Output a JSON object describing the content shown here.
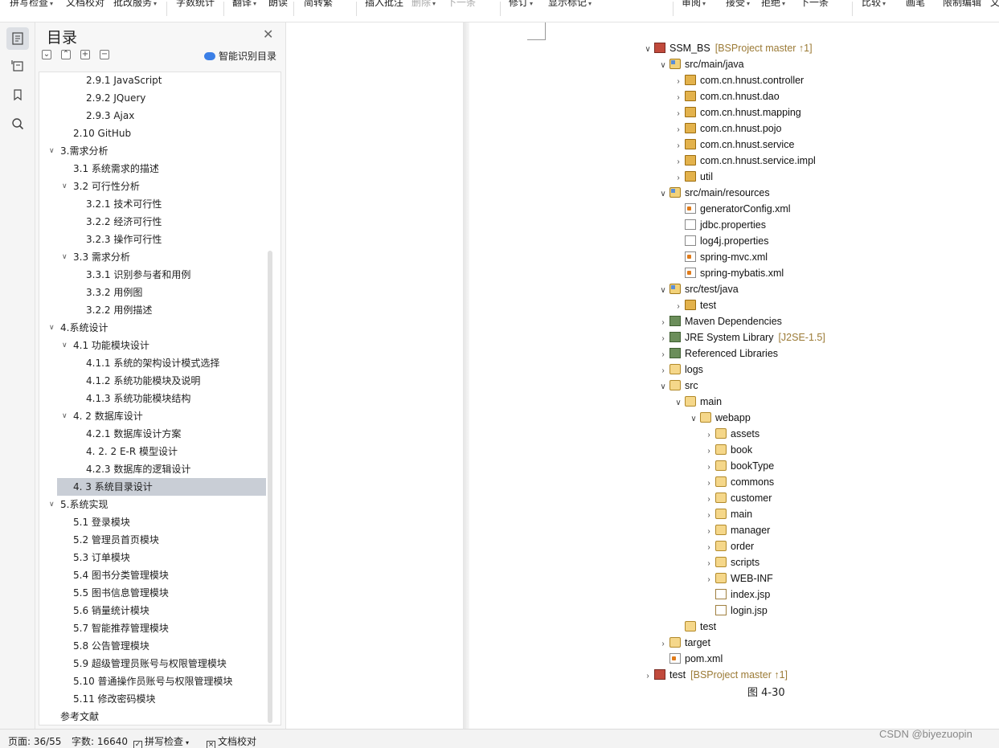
{
  "toolbar": {
    "items": [
      {
        "label": "拼写检查",
        "caret": true
      },
      {
        "label": "文档校对",
        "caret": false
      },
      {
        "label": "批改服务",
        "caret": true
      },
      {
        "label": "字数统计",
        "caret": false
      },
      {
        "label": "翻译",
        "caret": true
      },
      {
        "label": "朗读",
        "caret": false
      },
      {
        "label": "简转繁",
        "caret": false
      },
      {
        "label": "插入批注",
        "caret": false
      },
      {
        "label": "删除",
        "caret": true,
        "disabled": true
      },
      {
        "label": "下一条",
        "caret": false,
        "disabled": true
      },
      {
        "label": "修订",
        "caret": true
      },
      {
        "label": "显示标记",
        "caret": true
      },
      {
        "label": "审阅",
        "caret": true
      },
      {
        "label": "接受",
        "caret": true
      },
      {
        "label": "拒绝",
        "caret": true
      },
      {
        "label": "下一条",
        "caret": false
      },
      {
        "label": "比较",
        "caret": true
      },
      {
        "label": "画笔",
        "caret": false
      },
      {
        "label": "限制编辑",
        "caret": false
      },
      {
        "label": "文",
        "caret": false
      }
    ]
  },
  "toc": {
    "title": "目录",
    "smart_label": "智能识别目录",
    "items": [
      {
        "text": "2.9.1 JavaScript",
        "level": 3,
        "arrow": ""
      },
      {
        "text": "2.9.2 JQuery",
        "level": 3,
        "arrow": ""
      },
      {
        "text": "2.9.3 Ajax",
        "level": 3,
        "arrow": ""
      },
      {
        "text": "2.10 GitHub",
        "level": 2,
        "arrow": ""
      },
      {
        "text": "3.需求分析",
        "level": 1,
        "arrow": "∨"
      },
      {
        "text": "3.1  系统需求的描述",
        "level": 2,
        "arrow": ""
      },
      {
        "text": "3.2  可行性分析",
        "level": 2,
        "arrow": "∨"
      },
      {
        "text": "3.2.1 技术可行性",
        "level": 3,
        "arrow": ""
      },
      {
        "text": "3.2.2 经济可行性",
        "level": 3,
        "arrow": ""
      },
      {
        "text": "3.2.3 操作可行性",
        "level": 3,
        "arrow": ""
      },
      {
        "text": "3.3  需求分析",
        "level": 2,
        "arrow": "∨"
      },
      {
        "text": "3.3.1  识别参与者和用例",
        "level": 3,
        "arrow": ""
      },
      {
        "text": "3.3.2  用例图",
        "level": 3,
        "arrow": ""
      },
      {
        "text": "3.2.2 用例描述",
        "level": 3,
        "arrow": ""
      },
      {
        "text": "4.系统设计",
        "level": 1,
        "arrow": "∨"
      },
      {
        "text": "4.1 功能模块设计",
        "level": 2,
        "arrow": "∨"
      },
      {
        "text": "4.1.1 系统的架构设计模式选择",
        "level": 3,
        "arrow": ""
      },
      {
        "text": "4.1.2 系统功能模块及说明",
        "level": 3,
        "arrow": ""
      },
      {
        "text": "4.1.3 系统功能模块结构",
        "level": 3,
        "arrow": ""
      },
      {
        "text": "4. 2 数据库设计",
        "level": 2,
        "arrow": "∨"
      },
      {
        "text": "4.2.1 数据库设计方案",
        "level": 3,
        "arrow": ""
      },
      {
        "text": "4. 2. 2 E-R 模型设计",
        "level": 3,
        "arrow": ""
      },
      {
        "text": "4.2.3 数据库的逻辑设计",
        "level": 3,
        "arrow": ""
      },
      {
        "text": "4. 3  系统目录设计",
        "level": 2,
        "arrow": "",
        "selected": true
      },
      {
        "text": "5.系统实现",
        "level": 1,
        "arrow": "∨"
      },
      {
        "text": "5.1  登录模块",
        "level": 2,
        "arrow": ""
      },
      {
        "text": "5.2  管理员首页模块",
        "level": 2,
        "arrow": ""
      },
      {
        "text": "5.3  订单模块",
        "level": 2,
        "arrow": ""
      },
      {
        "text": "5.4  图书分类管理模块",
        "level": 2,
        "arrow": ""
      },
      {
        "text": "5.5  图书信息管理模块",
        "level": 2,
        "arrow": ""
      },
      {
        "text": "5.6  销量统计模块",
        "level": 2,
        "arrow": ""
      },
      {
        "text": "5.7  智能推荐管理模块",
        "level": 2,
        "arrow": ""
      },
      {
        "text": "5.8  公告管理模块",
        "level": 2,
        "arrow": ""
      },
      {
        "text": "5.9  超级管理员账号与权限管理模块",
        "level": 2,
        "arrow": ""
      },
      {
        "text": "5.10  普通操作员账号与权限管理模块",
        "level": 2,
        "arrow": ""
      },
      {
        "text": "5.11  修改密码模块",
        "level": 2,
        "arrow": ""
      },
      {
        "text": "参考文献",
        "level": 1,
        "arrow": ""
      }
    ]
  },
  "tree": {
    "rows": [
      {
        "indent": 0,
        "twisty": "∨",
        "icon": "proj",
        "label": "SSM_BS",
        "extra": "[BSProject master ↑1]"
      },
      {
        "indent": 1,
        "twisty": "∨",
        "icon": "srcfolder",
        "label": "src/main/java",
        "extra": ""
      },
      {
        "indent": 2,
        "twisty": "›",
        "icon": "pkg",
        "label": "com.cn.hnust.controller",
        "extra": ""
      },
      {
        "indent": 2,
        "twisty": "›",
        "icon": "pkg",
        "label": "com.cn.hnust.dao",
        "extra": ""
      },
      {
        "indent": 2,
        "twisty": "›",
        "icon": "pkg",
        "label": "com.cn.hnust.mapping",
        "extra": ""
      },
      {
        "indent": 2,
        "twisty": "›",
        "icon": "pkg",
        "label": "com.cn.hnust.pojo",
        "extra": ""
      },
      {
        "indent": 2,
        "twisty": "›",
        "icon": "pkg",
        "label": "com.cn.hnust.service",
        "extra": ""
      },
      {
        "indent": 2,
        "twisty": "›",
        "icon": "pkg",
        "label": "com.cn.hnust.service.impl",
        "extra": ""
      },
      {
        "indent": 2,
        "twisty": "›",
        "icon": "pkg",
        "label": "util",
        "extra": ""
      },
      {
        "indent": 1,
        "twisty": "∨",
        "icon": "srcfolder",
        "label": "src/main/resources",
        "extra": ""
      },
      {
        "indent": 2,
        "twisty": "",
        "icon": "xml",
        "label": "generatorConfig.xml",
        "extra": ""
      },
      {
        "indent": 2,
        "twisty": "",
        "icon": "file",
        "label": "jdbc.properties",
        "extra": ""
      },
      {
        "indent": 2,
        "twisty": "",
        "icon": "file",
        "label": "log4j.properties",
        "extra": ""
      },
      {
        "indent": 2,
        "twisty": "",
        "icon": "xml",
        "label": "spring-mvc.xml",
        "extra": ""
      },
      {
        "indent": 2,
        "twisty": "",
        "icon": "xml",
        "label": "spring-mybatis.xml",
        "extra": ""
      },
      {
        "indent": 1,
        "twisty": "∨",
        "icon": "srcfolder",
        "label": "src/test/java",
        "extra": ""
      },
      {
        "indent": 2,
        "twisty": "›",
        "icon": "pkg",
        "label": "test",
        "extra": ""
      },
      {
        "indent": 1,
        "twisty": "›",
        "icon": "lib",
        "label": "Maven Dependencies",
        "extra": ""
      },
      {
        "indent": 1,
        "twisty": "›",
        "icon": "lib",
        "label": "JRE System Library",
        "extra": "[J2SE-1.5]"
      },
      {
        "indent": 1,
        "twisty": "›",
        "icon": "lib",
        "label": "Referenced Libraries",
        "extra": ""
      },
      {
        "indent": 1,
        "twisty": "›",
        "icon": "folder",
        "label": "logs",
        "extra": ""
      },
      {
        "indent": 1,
        "twisty": "∨",
        "icon": "folder",
        "label": "src",
        "extra": ""
      },
      {
        "indent": 2,
        "twisty": "∨",
        "icon": "folder",
        "label": "main",
        "extra": ""
      },
      {
        "indent": 3,
        "twisty": "∨",
        "icon": "folder",
        "label": "webapp",
        "extra": ""
      },
      {
        "indent": 4,
        "twisty": "›",
        "icon": "folder",
        "label": "assets",
        "extra": ""
      },
      {
        "indent": 4,
        "twisty": "›",
        "icon": "folder",
        "label": "book",
        "extra": ""
      },
      {
        "indent": 4,
        "twisty": "›",
        "icon": "folder",
        "label": "bookType",
        "extra": ""
      },
      {
        "indent": 4,
        "twisty": "›",
        "icon": "folder",
        "label": "commons",
        "extra": ""
      },
      {
        "indent": 4,
        "twisty": "›",
        "icon": "folder",
        "label": "customer",
        "extra": ""
      },
      {
        "indent": 4,
        "twisty": "›",
        "icon": "folder",
        "label": "main",
        "extra": ""
      },
      {
        "indent": 4,
        "twisty": "›",
        "icon": "folder",
        "label": "manager",
        "extra": ""
      },
      {
        "indent": 4,
        "twisty": "›",
        "icon": "folder",
        "label": "order",
        "extra": ""
      },
      {
        "indent": 4,
        "twisty": "›",
        "icon": "folder",
        "label": "scripts",
        "extra": ""
      },
      {
        "indent": 4,
        "twisty": "›",
        "icon": "folder",
        "label": "WEB-INF",
        "extra": ""
      },
      {
        "indent": 4,
        "twisty": "",
        "icon": "jsp",
        "label": "index.jsp",
        "extra": ""
      },
      {
        "indent": 4,
        "twisty": "",
        "icon": "jsp",
        "label": "login.jsp",
        "extra": ""
      },
      {
        "indent": 2,
        "twisty": "",
        "icon": "folder",
        "label": "test",
        "extra": ""
      },
      {
        "indent": 1,
        "twisty": "›",
        "icon": "folder",
        "label": "target",
        "extra": ""
      },
      {
        "indent": 1,
        "twisty": "",
        "icon": "xml",
        "label": "pom.xml",
        "extra": ""
      },
      {
        "indent": 0,
        "twisty": "›",
        "icon": "proj",
        "label": "test",
        "extra": "[BSProject master ↑1]"
      }
    ],
    "caption": "图 4-30"
  },
  "status": {
    "page": "页面: 36/55",
    "words": "字数: 16640",
    "spell": "拼写检查",
    "proof": "文档校对"
  },
  "watermark": "CSDN @biyezuopin"
}
